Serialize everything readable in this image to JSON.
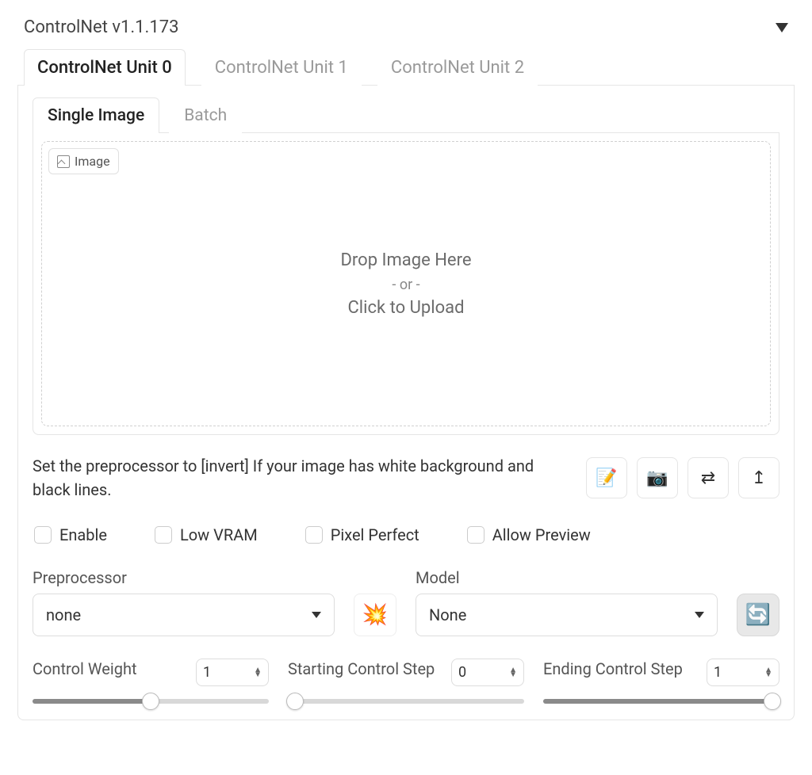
{
  "panel": {
    "title": "ControlNet v1.1.173"
  },
  "unitTabs": [
    "ControlNet Unit 0",
    "ControlNet Unit 1",
    "ControlNet Unit 2"
  ],
  "imageTabs": [
    "Single Image",
    "Batch"
  ],
  "imageChip": "Image",
  "dropzone": {
    "line1": "Drop Image Here",
    "or": "- or -",
    "line2": "Click to Upload"
  },
  "hint": "Set the preprocessor to [invert] If your image has white background and black lines.",
  "toolButtons": {
    "notepad": "📝",
    "camera": "📷",
    "swap": "⇄",
    "sendUp": "↥"
  },
  "checks": {
    "enable": "Enable",
    "lowvram": "Low VRAM",
    "pixelperfect": "Pixel Perfect",
    "allowpreview": "Allow Preview"
  },
  "preprocessor": {
    "label": "Preprocessor",
    "value": "none"
  },
  "model": {
    "label": "Model",
    "value": "None"
  },
  "explosion": "💥",
  "refresh": "🔄",
  "sliders": {
    "weight": {
      "label": "Control Weight",
      "value": "1",
      "pos": 50
    },
    "start": {
      "label": "Starting Control Step",
      "value": "0",
      "pos": 3
    },
    "end": {
      "label": "Ending Control Step",
      "value": "1",
      "pos": 97
    }
  }
}
